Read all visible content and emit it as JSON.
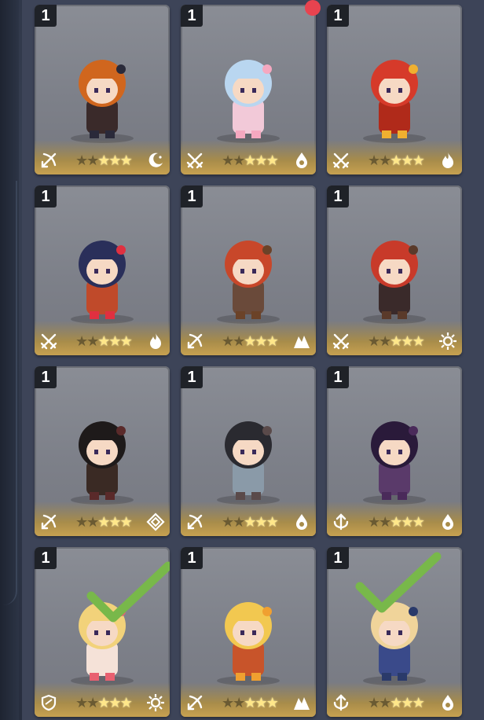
{
  "roster": {
    "cards": [
      {
        "level": "1",
        "role": "archer-icon",
        "element": "moon-icon",
        "stars_lit": 3,
        "stars_total": 5,
        "selected": false
      },
      {
        "level": "1",
        "role": "swords-icon",
        "element": "water-icon",
        "stars_lit": 3,
        "stars_total": 5,
        "selected": false
      },
      {
        "level": "1",
        "role": "swords-icon",
        "element": "fire-icon",
        "stars_lit": 3,
        "stars_total": 5,
        "selected": false
      },
      {
        "level": "1",
        "role": "swords-icon",
        "element": "fire-icon",
        "stars_lit": 3,
        "stars_total": 5,
        "selected": false
      },
      {
        "level": "1",
        "role": "archer-icon",
        "element": "earth-icon",
        "stars_lit": 3,
        "stars_total": 5,
        "selected": false
      },
      {
        "level": "1",
        "role": "swords-icon",
        "element": "light-icon",
        "stars_lit": 3,
        "stars_total": 5,
        "selected": false
      },
      {
        "level": "1",
        "role": "archer-icon",
        "element": "wind-icon",
        "stars_lit": 3,
        "stars_total": 5,
        "selected": false
      },
      {
        "level": "1",
        "role": "archer-icon",
        "element": "water-icon",
        "stars_lit": 3,
        "stars_total": 5,
        "selected": false
      },
      {
        "level": "1",
        "role": "support-icon",
        "element": "water-icon",
        "stars_lit": 3,
        "stars_total": 5,
        "selected": false
      },
      {
        "level": "1",
        "role": "shield-icon",
        "element": "light-icon",
        "stars_lit": 3,
        "stars_total": 5,
        "selected": true
      },
      {
        "level": "1",
        "role": "archer-icon",
        "element": "earth-icon",
        "stars_lit": 3,
        "stars_total": 5,
        "selected": false
      },
      {
        "level": "1",
        "role": "support-icon",
        "element": "water-icon",
        "stars_lit": 3,
        "stars_total": 5,
        "selected": true
      }
    ]
  },
  "colors": {
    "card_bg": "#8a8d95",
    "gold": "#c7a150",
    "check": "#78b84a",
    "notification": "#e8434f"
  }
}
